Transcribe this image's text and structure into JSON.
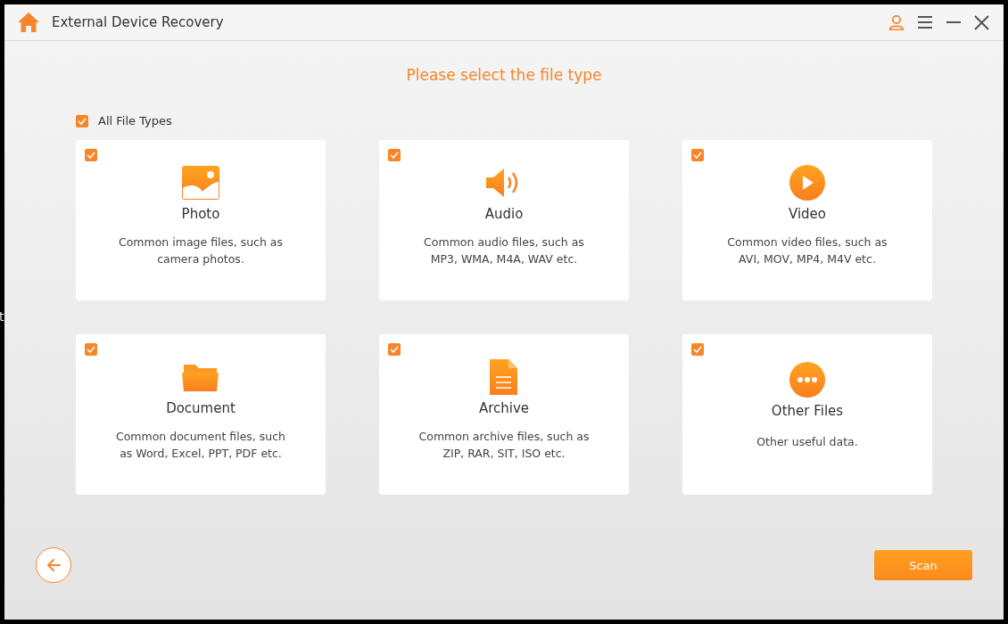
{
  "background_text": "t",
  "window": {
    "title": "External Device Recovery"
  },
  "heading": "Please select the file type",
  "all_types": {
    "label": "All File Types",
    "checked": true
  },
  "cards": [
    {
      "kind": "photo",
      "title": "Photo",
      "description": [
        "Common image files, such as",
        "camera photos."
      ],
      "checked": true
    },
    {
      "kind": "audio",
      "title": "Audio",
      "description": [
        "Common audio files, such as",
        "MP3, WMA, M4A, WAV etc."
      ],
      "checked": true
    },
    {
      "kind": "video",
      "title": "Video",
      "description": [
        "Common video files, such as",
        "AVI, MOV, MP4, M4V etc."
      ],
      "checked": true
    },
    {
      "kind": "document",
      "title": "Document",
      "description": [
        "Common document files, such",
        "as Word, Excel, PPT, PDF etc."
      ],
      "checked": true
    },
    {
      "kind": "archive",
      "title": "Archive",
      "description": [
        "Common archive files, such as",
        "ZIP, RAR, SIT, ISO etc."
      ],
      "checked": true
    },
    {
      "kind": "other",
      "title": "Other Files",
      "description": [
        "Other useful data."
      ],
      "checked": true
    }
  ],
  "scan_button": "Scan"
}
